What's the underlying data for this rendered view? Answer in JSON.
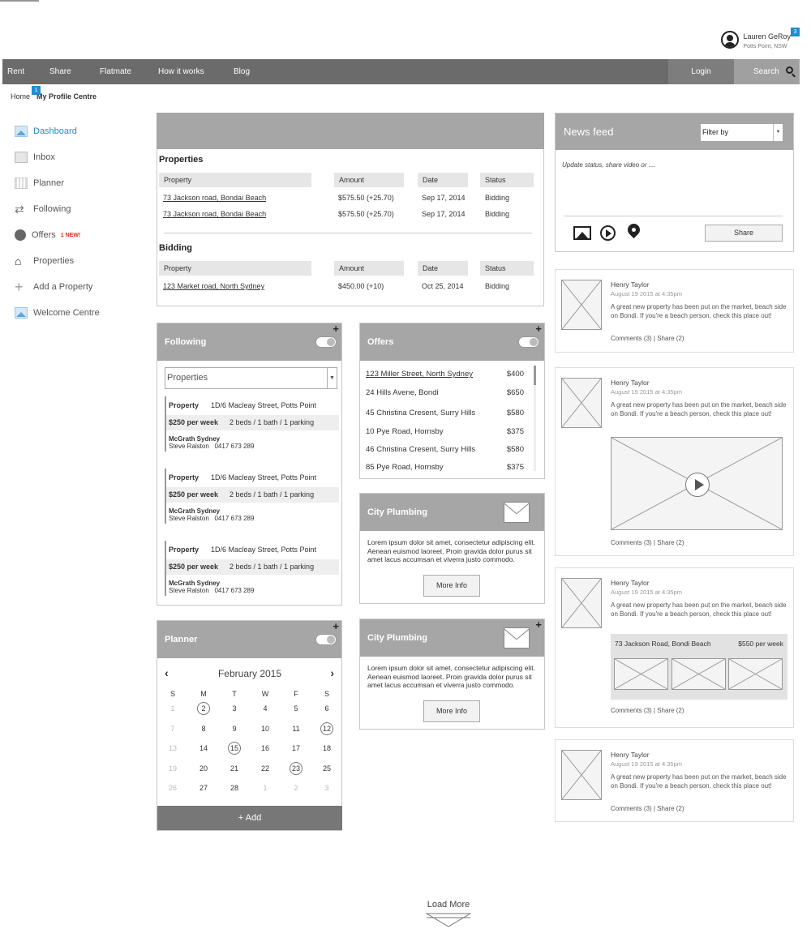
{
  "user": {
    "name": "Lauren GeRoy",
    "location": "Potts Point, NSW",
    "badge": "3"
  },
  "nav": {
    "items": [
      "Rent",
      "Share",
      "Flatmate",
      "How it works",
      "Blog"
    ],
    "login": "Login",
    "search": "Search"
  },
  "breadcrumb": {
    "home": "Home",
    "badge": "1",
    "current": "My Profile Centre"
  },
  "sidebar": [
    {
      "label": "Dashboard"
    },
    {
      "label": "Inbox"
    },
    {
      "label": "Planner"
    },
    {
      "label": "Following"
    },
    {
      "label": "Offers",
      "tag": "1 NEW!"
    },
    {
      "label": "Properties"
    },
    {
      "label": "Add a Property"
    },
    {
      "label": "Welcome Centre"
    }
  ],
  "properties": {
    "title": "Properties",
    "headers": [
      "Property",
      "Amount",
      "Date",
      "Status"
    ],
    "rows": [
      [
        "73 Jackson road, Bondai Beach",
        "$575.50 (+25.70)",
        "Sep 17, 2014",
        "Bidding"
      ],
      [
        "73 Jackson road, Bondai Beach",
        "$575.50 (+25.70)",
        "Sep 17, 2014",
        "Bidding"
      ]
    ],
    "bidding_title": "Bidding",
    "bidding_rows": [
      [
        "123 Market road, North Sydney",
        "$450.00 (+10)",
        "Oct 25, 2014",
        "Bidding"
      ]
    ]
  },
  "following": {
    "title": "Following",
    "select": "Properties",
    "items": [
      {
        "prop_label": "Property",
        "address": "1D/6 Macleay Street, Potts Point",
        "price": "$250 per week",
        "details": "2 beds / 1 bath / 1 parking",
        "agency": "McGrath Sydney",
        "agent": "Steve Ralston",
        "phone": "0417 673 289"
      },
      {
        "prop_label": "Property",
        "address": "1D/6 Macleay Street, Potts Point",
        "price": "$250 per week",
        "details": "2 beds / 1 bath / 1 parking",
        "agency": "McGrath Sydney",
        "agent": "Steve Ralston",
        "phone": "0417 673 289"
      },
      {
        "prop_label": "Property",
        "address": "1D/6 Macleay Street, Potts Point",
        "price": "$250 per week",
        "details": "2 beds / 1 bath / 1 parking",
        "agency": "McGrath Sydney",
        "agent": "Steve Ralston",
        "phone": "0417 673 289"
      }
    ]
  },
  "offers": {
    "title": "Offers",
    "items": [
      {
        "address": "123 Miller Street, North Sydney",
        "price": "$400"
      },
      {
        "address": "24 Hills Avene, Bondi",
        "price": "$650"
      },
      {
        "address": "45 Christina Cresent, Surry Hills",
        "price": "$580"
      },
      {
        "address": "10 Pye Road, Hornsby",
        "price": "$375"
      },
      {
        "address": "46 Christina Cresent, Surry Hills",
        "price": "$580"
      },
      {
        "address": "85 Pye Road, Hornsby",
        "price": "$375"
      }
    ]
  },
  "ads": [
    {
      "title": "City Plumbing",
      "text": "Lorem ipsum dolor sit amet, consectetur adipiscing elit. Aenean euismod laoreet. Proin gravida dolor purus sit amet lacus accumsan et viverra justo commodo.",
      "button": "More Info"
    },
    {
      "title": "City Plumbing",
      "text": "Lorem ipsum dolor sit amet, consectetur adipiscing elit. Aenean euismod laoreet. Proin gravida dolor purus sit amet lacus accumsan et viverra justo commodo.",
      "button": "More Info"
    }
  ],
  "planner": {
    "title": "Planner",
    "month": "February 2015",
    "weekdays": [
      "S",
      "M",
      "T",
      "W",
      "F",
      "S"
    ],
    "weeks": [
      [
        {
          "d": "1",
          "m": true
        },
        {
          "d": "2",
          "c": true
        },
        {
          "d": "3"
        },
        {
          "d": "4"
        },
        {
          "d": "5"
        },
        {
          "d": "6"
        }
      ],
      [
        {
          "d": "7",
          "m": true
        },
        {
          "d": "8"
        },
        {
          "d": "9"
        },
        {
          "d": "10"
        },
        {
          "d": "11"
        },
        {
          "d": "12",
          "c": true
        }
      ],
      [
        {
          "d": "13",
          "m": true
        },
        {
          "d": "14"
        },
        {
          "d": "15",
          "c": true
        },
        {
          "d": "16"
        },
        {
          "d": "17"
        },
        {
          "d": "18"
        }
      ],
      [
        {
          "d": "19",
          "m": true
        },
        {
          "d": "20"
        },
        {
          "d": "21"
        },
        {
          "d": "22"
        },
        {
          "d": "23",
          "c": true
        },
        {
          "d": "25"
        }
      ],
      [
        {
          "d": "26",
          "m": true
        },
        {
          "d": "27"
        },
        {
          "d": "28"
        },
        {
          "d": "1",
          "m": true
        },
        {
          "d": "2",
          "m": true
        },
        {
          "d": "3",
          "m": true
        }
      ]
    ],
    "add": "+ Add"
  },
  "newsfeed": {
    "title": "News feed",
    "filter": "Filter by",
    "placeholder": "Update status, share video or ....",
    "share": "Share",
    "posts": [
      {
        "name": "Henry Taylor",
        "date": "August 19 2015 at 4:35pm",
        "text": "A great new property has been put on the  market, beach side on Bondi. If you're a beach person, check this place out!",
        "meta": "Comments (3) | Share (2)"
      },
      {
        "name": "Henry Taylor",
        "date": "August 19 2015 at 4:35pm",
        "text": "A great new property has been put on the  market, beach side on Bondi. If you're a beach person, check this place out!",
        "meta": "Comments (3) | Share (2)"
      },
      {
        "name": "Henry Taylor",
        "date": "August 19 2015 at 4:35pm",
        "text": "A great new property has been put on the  market, beach side on Bondi. If you're a beach person, check this place out!",
        "meta": "Comments (3) | Share (2)",
        "listing_address": "73 Jackson Road, Bondi Beach",
        "listing_price": "$550 per week"
      },
      {
        "name": "Henry Taylor",
        "date": "August 19 2015 at 4:35pm",
        "text": "A great new property has been put on the  market, beach side on Bondi. If you're a beach person, check this place out!",
        "meta": "Comments (3) | Share (2)"
      }
    ]
  },
  "load_more": "Load More"
}
